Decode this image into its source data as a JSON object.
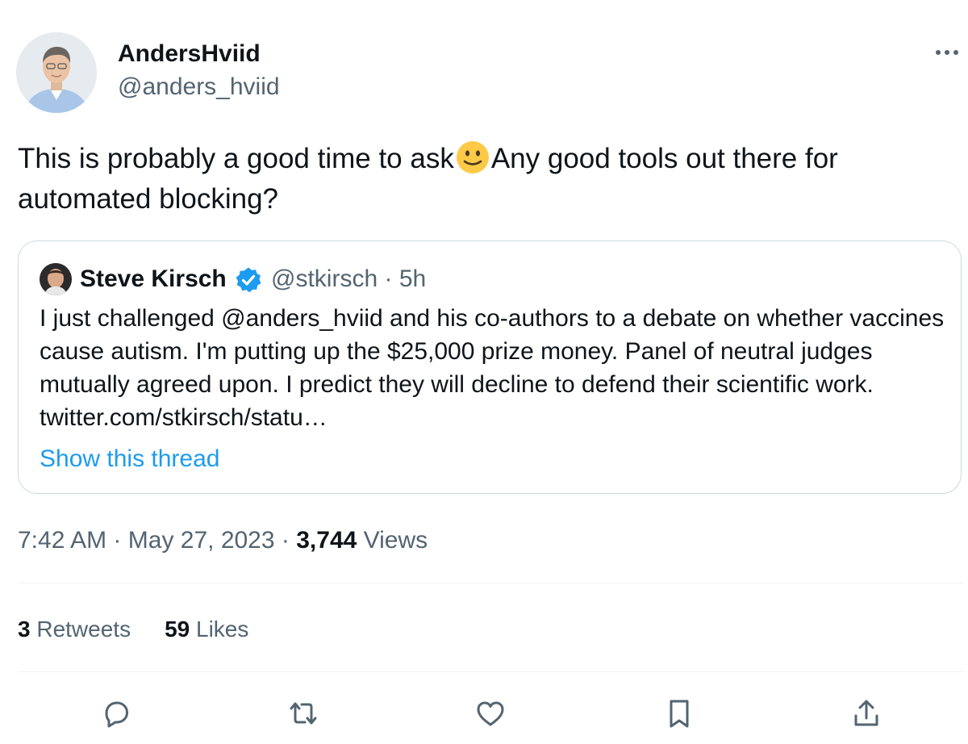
{
  "author": {
    "display_name": "AndersHviid",
    "handle": "@anders_hviid",
    "avatar_icon": "user-avatar-photo"
  },
  "more_icon": "more-horizontal-icon",
  "tweet": {
    "text_before_emoji": "This is probably a good time to ask",
    "emoji": "slightly-smiling-face",
    "text_after_emoji": "Any good tools out there for automated blocking?"
  },
  "quoted": {
    "name": "Steve Kirsch",
    "verified_icon": "verified-badge-icon",
    "handle": "@stkirsch",
    "separator": "·",
    "time": "5h",
    "text": "I just challenged @anders_hviid and his co-authors to a debate on whether vaccines cause autism. I'm putting up the $25,000 prize money. Panel of neutral judges mutually agreed upon. I predict they will decline to defend their scientific work. twitter.com/stkirsch/statu…",
    "show_thread": "Show this thread"
  },
  "timestamp": {
    "time": "7:42 AM",
    "separator1": "·",
    "date": "May 27, 2023",
    "separator2": "·",
    "views_count": "3,744",
    "views_label": "Views"
  },
  "stats": {
    "retweets_count": "3",
    "retweets_label": "Retweets",
    "likes_count": "59",
    "likes_label": "Likes"
  },
  "actions": [
    "reply-icon",
    "retweet-icon",
    "like-icon",
    "bookmark-icon",
    "share-icon"
  ],
  "colors": {
    "text": "#0f1419",
    "secondary": "#536471",
    "link": "#1d9bf0",
    "border": "#cfd9de",
    "verified": "#1d9bf0"
  }
}
